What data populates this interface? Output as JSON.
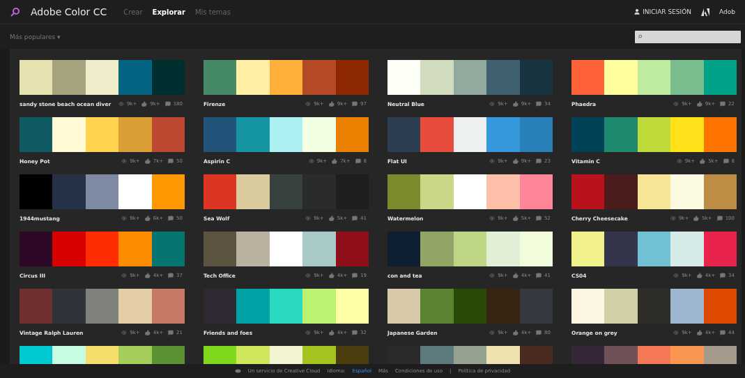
{
  "app": {
    "title": "Adobe Color CC",
    "partner": "Adob"
  },
  "nav": [
    {
      "label": "Crear",
      "selected": false
    },
    {
      "label": "Explorar",
      "selected": true
    },
    {
      "label": "Mis temas",
      "selected": false
    }
  ],
  "sign_in": "INICIAR SESIÓN",
  "sort": {
    "label": "Más populares",
    "caret": "▾"
  },
  "themes": [
    {
      "name": "sandy stone beach ocean diver",
      "swatches": [
        {
          "color": "#e6e2af"
        },
        {
          "color": "#a7a37e"
        },
        {
          "color": "#efecca"
        },
        {
          "color": "#046380"
        },
        {
          "color": "#002f2f"
        }
      ],
      "views": "9k+",
      "likes": "9k+",
      "comments": "180"
    },
    {
      "name": "Firenze",
      "swatches": [
        {
          "color": "#468966"
        },
        {
          "color": "#fff0a5"
        },
        {
          "color": "#ffb03b"
        },
        {
          "color": "#b64926"
        },
        {
          "color": "#8e2800"
        }
      ],
      "views": "9k+",
      "likes": "9k+",
      "comments": "97"
    },
    {
      "name": "Neutral Blue",
      "swatches": [
        {
          "color": "#fcfff5"
        },
        {
          "color": "#d1dbbd"
        },
        {
          "color": "#91aa9d"
        },
        {
          "color": "#3e606f"
        },
        {
          "color": "#193441"
        }
      ],
      "views": "9k+",
      "likes": "9k+",
      "comments": "34"
    },
    {
      "name": "Phaedra",
      "swatches": [
        {
          "color": "#ff6138"
        },
        {
          "color": "#ffff9d"
        },
        {
          "color": "#beeb9f"
        },
        {
          "color": "#79bd8f"
        },
        {
          "color": "#00a388"
        }
      ],
      "views": "9k+",
      "likes": "9k+",
      "comments": "22"
    },
    {
      "name": "Honey Pot",
      "swatches": [
        {
          "color": "#105b63"
        },
        {
          "color": "#fffad5"
        },
        {
          "color": "#ffd34e"
        },
        {
          "color": "#db9e36"
        },
        {
          "color": "#bd4932"
        }
      ],
      "views": "9k+",
      "likes": "7k+",
      "comments": "50"
    },
    {
      "name": "Aspirin C",
      "swatches": [
        {
          "color": "#225378"
        },
        {
          "color": "#1695a3"
        },
        {
          "color": "#acf0f2"
        },
        {
          "color": "#f3ffe2"
        },
        {
          "color": "#eb7f00"
        }
      ],
      "views": "9k+",
      "likes": "7k+",
      "comments": "8"
    },
    {
      "name": "Flat UI",
      "swatches": [
        {
          "color": "#2c3e50"
        },
        {
          "color": "#e74c3c"
        },
        {
          "color": "#ecf0f1"
        },
        {
          "color": "#3498db"
        },
        {
          "color": "#2980b9"
        }
      ],
      "views": "9k+",
      "likes": "9k+",
      "comments": "23"
    },
    {
      "name": "Vitamin C",
      "swatches": [
        {
          "color": "#004358"
        },
        {
          "color": "#1f8a70"
        },
        {
          "color": "#bedb39"
        },
        {
          "color": "#ffe11a"
        },
        {
          "color": "#fd7400"
        }
      ],
      "views": "9k+",
      "likes": "5k+",
      "comments": "8"
    },
    {
      "name": "1944mustang",
      "swatches": [
        {
          "color": "#000000"
        },
        {
          "color": "#263248"
        },
        {
          "color": "#7e8aa2"
        },
        {
          "color": "#ffffff"
        },
        {
          "color": "#ff9800"
        }
      ],
      "views": "9k+",
      "likes": "6k+",
      "comments": "50"
    },
    {
      "name": "Sea Wolf",
      "swatches": [
        {
          "color": "#dc3522"
        },
        {
          "color": "#d9cb9e"
        },
        {
          "color": "#374140"
        },
        {
          "color": "#2a2c2b"
        },
        {
          "color": "#1e1e20"
        }
      ],
      "views": "9k+",
      "likes": "5k+",
      "comments": "41"
    },
    {
      "name": "Watermelon",
      "swatches": [
        {
          "color": "#7d8a2e"
        },
        {
          "color": "#c9d787"
        },
        {
          "color": "#ffffff"
        },
        {
          "color": "#ffc0a9"
        },
        {
          "color": "#ff8598"
        }
      ],
      "views": "9k+",
      "likes": "5k+",
      "comments": "52"
    },
    {
      "name": "Cherry Cheesecake",
      "swatches": [
        {
          "color": "#b9121b"
        },
        {
          "color": "#4c1b1b"
        },
        {
          "color": "#f6e497"
        },
        {
          "color": "#fcfae1"
        },
        {
          "color": "#bd8d46"
        }
      ],
      "views": "9k+",
      "likes": "5k+",
      "comments": "100"
    },
    {
      "name": "Circus III",
      "swatches": [
        {
          "color": "#2e0927"
        },
        {
          "color": "#d90000"
        },
        {
          "color": "#ff2d00"
        },
        {
          "color": "#ff8c00"
        },
        {
          "color": "#04756f"
        }
      ],
      "views": "9k+",
      "likes": "4k+",
      "comments": "37"
    },
    {
      "name": "Tech Office",
      "swatches": [
        {
          "color": "#5c5340"
        },
        {
          "color": "#bbb1a0"
        },
        {
          "color": "#ffffff"
        },
        {
          "color": "#a8c9c7"
        },
        {
          "color": "#8e0e1a"
        }
      ],
      "views": "9k+",
      "likes": "4k+",
      "comments": "19"
    },
    {
      "name": "con and tea",
      "swatches": [
        {
          "color": "#0d1f30"
        },
        {
          "color": "#91a566"
        },
        {
          "color": "#bdd684"
        },
        {
          "color": "#e2efd7"
        },
        {
          "color": "#f1fcdc"
        }
      ],
      "views": "9k+",
      "likes": "4k+",
      "comments": "41"
    },
    {
      "name": "CS04",
      "swatches": [
        {
          "color": "#f2f28a"
        },
        {
          "color": "#33354a"
        },
        {
          "color": "#70c1d4"
        },
        {
          "color": "#d6ebe7"
        },
        {
          "color": "#e8244c"
        }
      ],
      "views": "9k+",
      "likes": "4k+",
      "comments": "34"
    },
    {
      "name": "Vintage Ralph Lauren",
      "swatches": [
        {
          "color": "#703030"
        },
        {
          "color": "#2f343b"
        },
        {
          "color": "#7e827a"
        },
        {
          "color": "#e3cda4"
        },
        {
          "color": "#c77966"
        }
      ],
      "views": "9k+",
      "likes": "4k+",
      "comments": "21"
    },
    {
      "name": "Friends and foes",
      "swatches": [
        {
          "color": "#2f2933"
        },
        {
          "color": "#01a2a6"
        },
        {
          "color": "#29d9c2"
        },
        {
          "color": "#bdf271"
        },
        {
          "color": "#ffffa6"
        }
      ],
      "views": "9k+",
      "likes": "4k+",
      "comments": "32"
    },
    {
      "name": "Japanese Garden",
      "swatches": [
        {
          "color": "#d8caa8"
        },
        {
          "color": "#5c832f"
        },
        {
          "color": "#284907"
        },
        {
          "color": "#382513"
        },
        {
          "color": "#363942"
        }
      ],
      "views": "9k+",
      "likes": "4k+",
      "comments": "80"
    },
    {
      "name": "Orange on grey",
      "swatches": [
        {
          "color": "#fdf6e3"
        },
        {
          "color": "#d3cfa5"
        },
        {
          "color": "#2e2d29"
        },
        {
          "color": "#9fb6d2"
        },
        {
          "color": "#de4b00"
        }
      ],
      "views": "9k+",
      "likes": "4k+",
      "comments": "44"
    },
    {
      "swatches": [
        {
          "color": "#00c8d0"
        },
        {
          "color": "#c6fce1"
        },
        {
          "color": "#f6de6c"
        },
        {
          "color": "#a5cd5b"
        },
        {
          "color": "#5a9232"
        }
      ]
    },
    {
      "swatches": [
        {
          "color": "#7fd81c"
        },
        {
          "color": "#cfe75a"
        },
        {
          "color": "#f3f4d4"
        },
        {
          "color": "#a5c31e"
        },
        {
          "color": "#4b3e0e"
        }
      ]
    },
    {
      "swatches": [
        {
          "color": "#2a2a2a"
        },
        {
          "color": "#5d7a7c"
        },
        {
          "color": "#95a290"
        },
        {
          "color": "#f0e2b0"
        },
        {
          "color": "#4a2b20"
        }
      ]
    },
    {
      "swatches": [
        {
          "color": "#352638"
        },
        {
          "color": "#6f5158"
        },
        {
          "color": "#f57855"
        },
        {
          "color": "#fa9650"
        },
        {
          "color": "#a39a8c"
        }
      ]
    }
  ],
  "footer": {
    "service": "Un servicio de Creative Cloud",
    "language_label": "Idioma:",
    "language": "Español",
    "more": "Más",
    "terms": "Condiciones de uso",
    "separator": "|",
    "privacy": "Política de privacidad"
  }
}
